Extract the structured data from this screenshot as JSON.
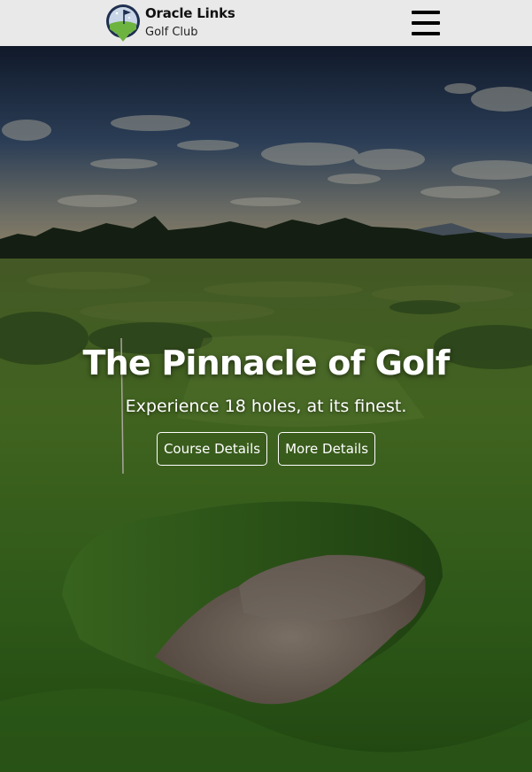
{
  "header": {
    "brand_name": "Oracle Links",
    "brand_sub": "Golf Club",
    "logo_icon": "golf-flag-logo-icon",
    "menu_icon": "hamburger-menu-icon"
  },
  "hero": {
    "title": "The Pinnacle of Golf",
    "subtitle": "Experience 18 holes, at its finest.",
    "buttons": [
      {
        "label": "Course Details"
      },
      {
        "label": "More Details"
      }
    ]
  },
  "colors": {
    "header_bg": "#e9e9e9",
    "text_light": "#ffffff",
    "logo_navy": "#1f2f4f",
    "logo_green": "#6db33f"
  }
}
